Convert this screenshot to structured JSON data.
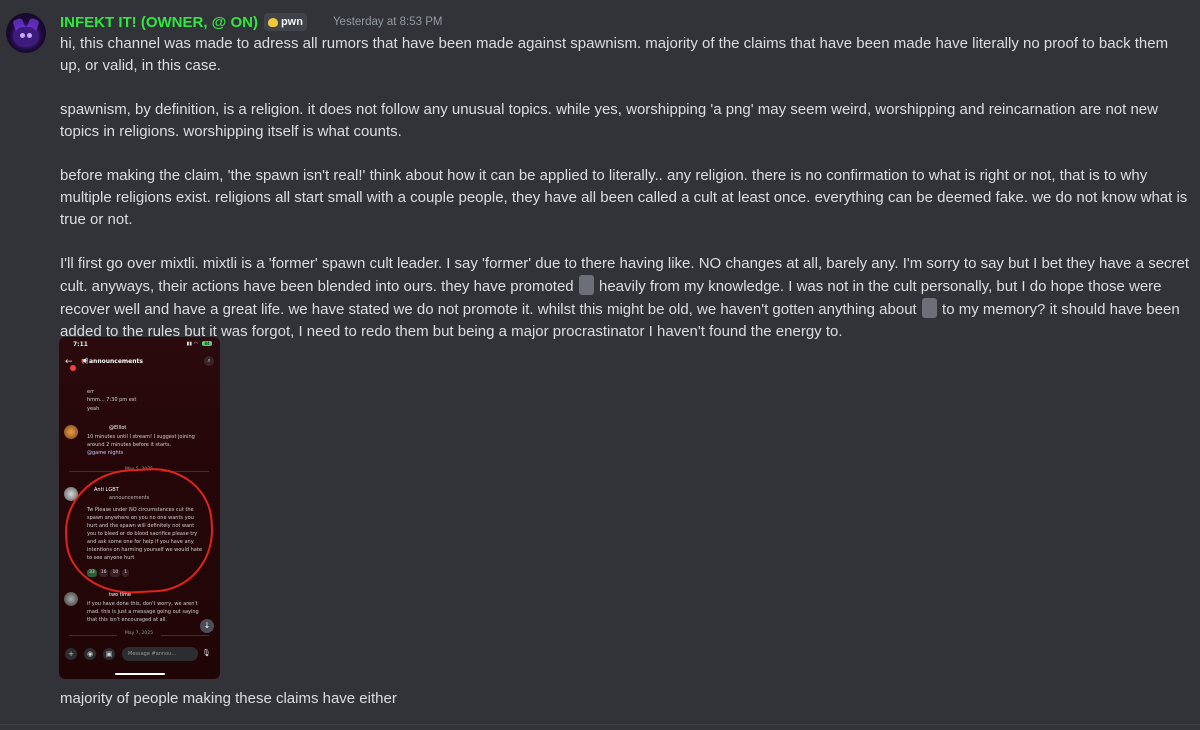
{
  "message": {
    "author": "INFEKT IT! (OWNER, @ ON)",
    "tag": "pwn",
    "timestamp": "Yesterday at 8:53 PM",
    "p1": "hi, this channel was made to adress all rumors that have been made against spawnism. majority of the claims that have been made have literally no proof to back them up, or valid, in this case.",
    "p2": "spawnism, by definition, is a religion. it does not follow any unusual topics. while yes, worshipping 'a png' may seem weird, worshipping and reincarnation are not new topics in religions. worshipping itself is what counts.",
    "p3": "before making the claim, 'the spawn isn't real!' think about how it can be applied to literally.. any religion. there is no confirmation to what is right or not, that is to why multiple religions exist. religions all start small with a couple people, they have all been called a cult at least once. everything can be deemed fake. we do not know what is true or not.",
    "p4a": "I'll first go over mixtli. mixtli is a 'former' spawn cult leader. I say 'former' due to there having like. NO changes at all, barely any. I'm sorry to say but I bet they have a secret cult. anyways, their actions have been blended into ours. they have promoted",
    "p4b": "heavily from my knowledge. I was not in the cult personally, but I do hope those were recover well and have a great life. we have stated we do not promote it. whilst this might be old, we haven't gotten anything about",
    "p4c": "to my memory? it should have been added to the rules but it was forgot, I need to redo them but being a major procrastinator I haven't found the energy to.",
    "p5": "majority of people making these claims have either"
  },
  "screenshot": {
    "status_time": "7:11",
    "battery": "84",
    "channel": "announcements",
    "line_a": "err",
    "line_b": "hmm... 7:30 pm est",
    "line_c": "yeah",
    "msg1_author": "@Elliot",
    "msg1_line1": "10 minutes until I stream! I suggest joining",
    "msg1_line2": "around 2 minutes before it starts.",
    "msg1_line3": "@game nights",
    "date1": "May 5, 2025",
    "msg2_author": "Anti LGBT",
    "msg2_sub": "announcements",
    "msg2_l1": "Tw Please under NO circumstances cut the",
    "msg2_l2": "spawn anywhere on you no one wants you",
    "msg2_l3": "hurt and the spawn will definitely not want",
    "msg2_l4": "you to bleed or do blood sacrifice please try",
    "msg2_l5": "and ask some one for help if you have any",
    "msg2_l6": "intentions on harming yourself we would hate",
    "msg2_l7": "to see anyone hurt",
    "r1": "33",
    "r2": "16",
    "r3": "10",
    "r4": "1",
    "msg3_author": "two time",
    "msg3_l1": "if you have done this, don't worry, we aren't",
    "msg3_l2": "mad. this is just a message going out saying",
    "msg3_l3": "that this isn't encouraged at all.",
    "date2": "May 7, 2025",
    "composer_placeholder": "Message #annou..."
  }
}
